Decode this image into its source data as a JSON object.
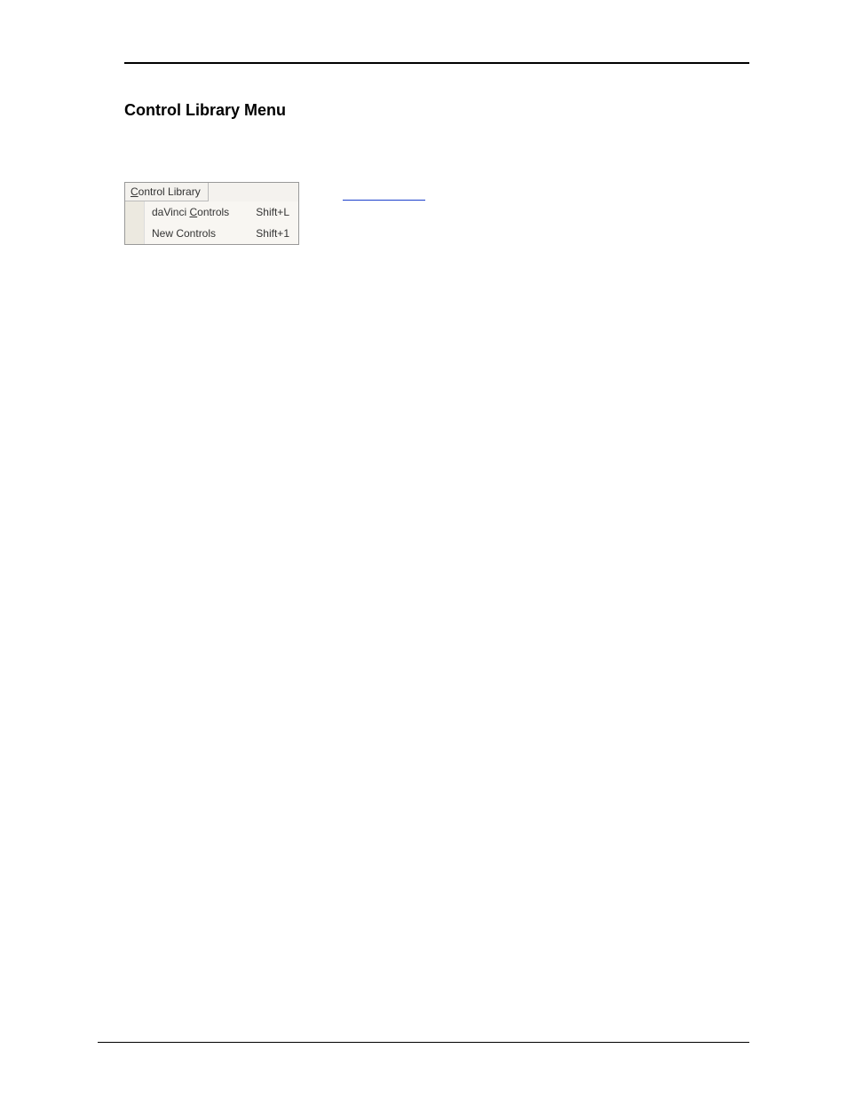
{
  "heading": "Control Library Menu",
  "menu": {
    "title_prefix": "C",
    "title_rest": "ontrol Library",
    "items": [
      {
        "label_before": "daVinci ",
        "label_underline": "C",
        "label_after": "ontrols",
        "shortcut": "Shift+L"
      },
      {
        "label_before": "New Controls",
        "label_underline": "",
        "label_after": "",
        "shortcut": "Shift+1"
      }
    ]
  }
}
